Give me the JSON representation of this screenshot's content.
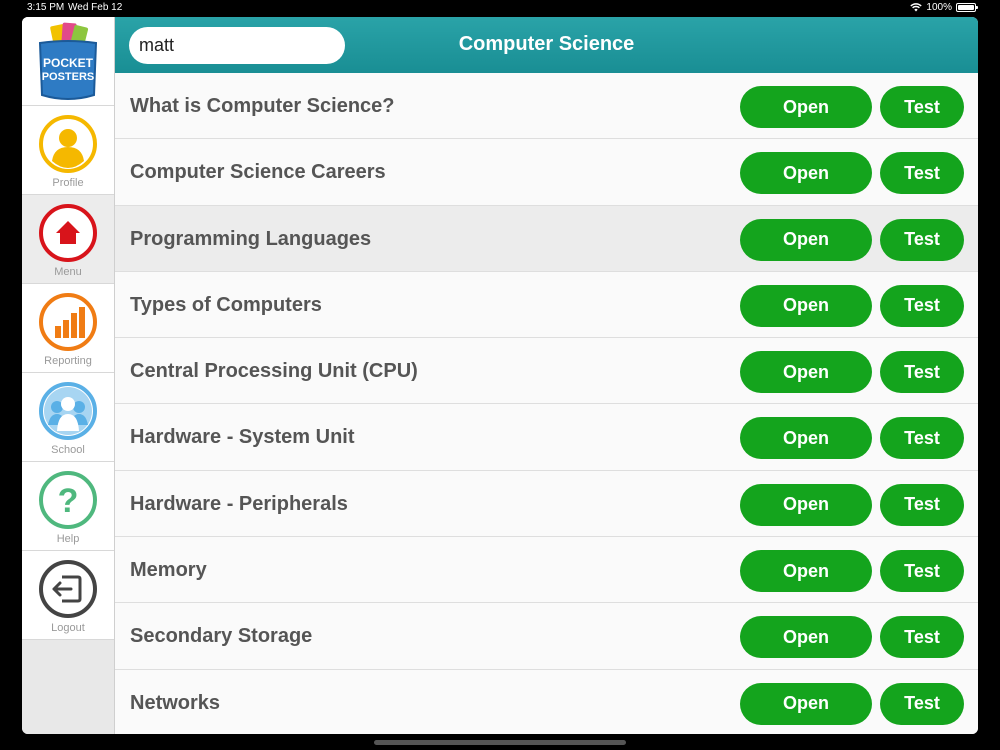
{
  "status": {
    "time": "3:15 PM",
    "date": "Wed Feb 12",
    "battery": "100%"
  },
  "logo": {
    "line1": "POCKET",
    "line2": "POSTERS"
  },
  "sidebar": {
    "items": [
      {
        "label": "Profile",
        "icon": "profile-icon",
        "color": "#f5b800"
      },
      {
        "label": "Menu",
        "icon": "home-icon",
        "color": "#d8141b"
      },
      {
        "label": "Reporting",
        "icon": "bar-chart-icon",
        "color": "#f07c14"
      },
      {
        "label": "School",
        "icon": "people-icon",
        "color": "#5ab0e6"
      },
      {
        "label": "Help",
        "icon": "question-icon",
        "color": "#4fb87e"
      },
      {
        "label": "Logout",
        "icon": "logout-icon",
        "color": "#444444"
      }
    ]
  },
  "header": {
    "search_value": "matt",
    "title": "Computer Science"
  },
  "buttons": {
    "open": "Open",
    "test": "Test"
  },
  "topics": [
    "What is Computer Science?",
    "Computer Science Careers",
    "Programming Languages",
    "Types of Computers",
    "Central Processing Unit (CPU)",
    "Hardware - System Unit",
    "Hardware - Peripherals",
    "Memory",
    "Secondary Storage",
    "Networks"
  ],
  "colors": {
    "header": "#2aa3a8",
    "button": "#14a41d"
  }
}
